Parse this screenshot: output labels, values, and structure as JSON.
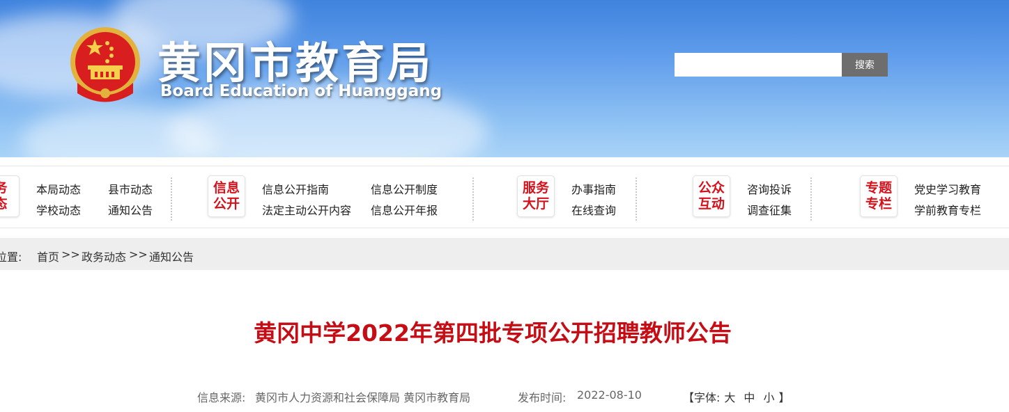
{
  "header": {
    "title": "黄冈市教育局",
    "subtitle": "Board Education of Huanggang",
    "search_placeholder": "",
    "search_button": "搜索"
  },
  "nav": {
    "groups": [
      {
        "badge": "务\n态",
        "links": [
          "本局动态",
          "县市动态",
          "学校动态",
          "通知公告"
        ]
      },
      {
        "badge": "信息\n公开",
        "links": [
          "信息公开指南",
          "信息公开制度",
          "法定主动公开内容",
          "信息公开年报"
        ]
      },
      {
        "badge": "服务\n大厅",
        "links": [
          "办事指南",
          "在线查询"
        ]
      },
      {
        "badge": "公众\n互动",
        "links": [
          "咨询投诉",
          "调查征集"
        ]
      },
      {
        "badge": "专题\n专栏",
        "links": [
          "党史学习教育",
          "学前教育专栏"
        ]
      }
    ]
  },
  "breadcrumb": {
    "prefix": "位置:",
    "home": "首页",
    "sep1": ">>",
    "section": "政务动态",
    "sep2": ">>",
    "current": "通知公告"
  },
  "article": {
    "title": "黄冈中学2022年第四批专项公开招聘教师公告",
    "source_label": "信息来源:",
    "source": "黄冈市人力资源和社会保障局 黄冈市教育局",
    "date_label": "发布时间:",
    "date": "2022-08-10",
    "font_label": "【字体:",
    "font_large": "大",
    "font_medium": "中",
    "font_small": "小",
    "font_close": "】"
  },
  "colors": {
    "accent_red": "#c40d14",
    "badge_red": "#d5121b",
    "banner_blue": "#3f83de"
  },
  "icons": [
    "national-emblem-icon"
  ]
}
